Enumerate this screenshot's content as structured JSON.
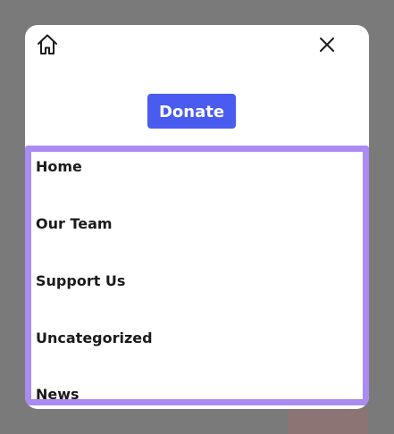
{
  "header": {
    "home_icon": "home-icon",
    "close_icon": "close-icon"
  },
  "donate": {
    "label": "Donate"
  },
  "nav": {
    "items": [
      {
        "label": "Home"
      },
      {
        "label": "Our Team"
      },
      {
        "label": "Support Us"
      },
      {
        "label": "Uncategorized"
      },
      {
        "label": "News"
      }
    ]
  },
  "colors": {
    "overlay": "#7a7a7a",
    "button": "#4a5cf0",
    "focus_ring": "#a98bf2",
    "text": "#1b1b1b"
  }
}
